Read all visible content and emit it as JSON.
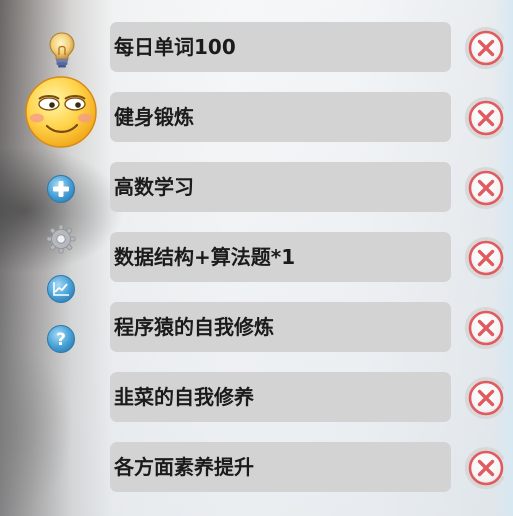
{
  "sidebar": {
    "icons": [
      "lightbulb-icon",
      "smiley-icon",
      "add-icon",
      "gear-icon",
      "chart-icon",
      "help-icon"
    ],
    "help_glyph": "?"
  },
  "tasks": [
    {
      "label": "每日单词100"
    },
    {
      "label": "健身锻炼"
    },
    {
      "label": "高数学习"
    },
    {
      "label": "数据结构+算法题*1"
    },
    {
      "label": "程序猿的自我修炼"
    },
    {
      "label": "韭菜的自我修养"
    },
    {
      "label": "各方面素养提升"
    }
  ],
  "colors": {
    "task_box": "#d3d3d3",
    "delete_red": "#e05a5f",
    "icon_blue": "#4aa3d8"
  }
}
